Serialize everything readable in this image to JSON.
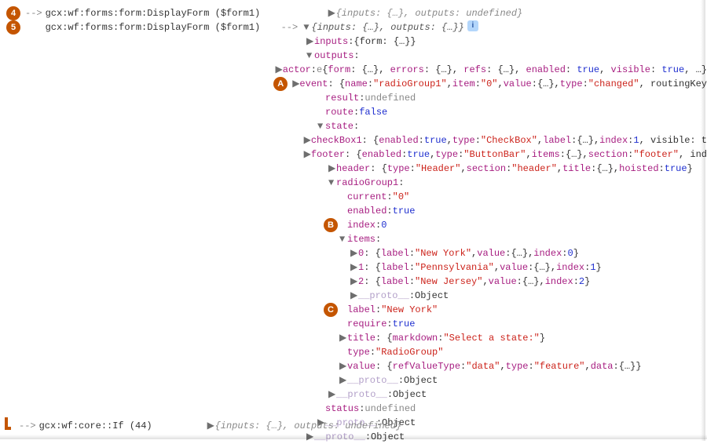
{
  "badges": {
    "n4": "4",
    "n5": "5",
    "A": "A",
    "B": "B",
    "C": "C"
  },
  "log": {
    "entry4": {
      "prefix": "-->",
      "fn": "gcx:wf:forms:form:DisplayForm ($form1)",
      "summary": "{inputs: {…}, outputs: undefined}"
    },
    "entry5": {
      "fn": "gcx:wf:forms:form:DisplayForm ($form1)",
      "arrow": "-->",
      "summary": "{inputs: {…}, outputs: {…}}"
    },
    "bottom": {
      "prefix": "-->",
      "fn": "gcx:wf:core::If (44)",
      "summary": "{inputs: {…}, outputs: undefined}"
    }
  },
  "inputs_line": {
    "key": "inputs",
    "val": "{form: {…}}"
  },
  "outputs_label": "outputs",
  "actor": {
    "key": "actor",
    "prefix": "e ",
    "val": "{form: {…}, errors: {…}, refs: {…}, enabled: true, visible: true, …}"
  },
  "event": {
    "key": "event",
    "name_k": "name",
    "name_v": "\"radioGroup1\"",
    "item_k": "item",
    "item_v": "\"0\"",
    "value_k": "value",
    "value_v": "{…}",
    "type_k": "type",
    "type_v": "\"changed\"",
    "rest": ", routingKey"
  },
  "result": {
    "key": "result",
    "val": "undefined"
  },
  "route": {
    "key": "route",
    "val": "false"
  },
  "state_label": "state",
  "checkBox1": {
    "key": "checkBox1",
    "enabled_k": "enabled",
    "enabled_v": "true",
    "type_k": "type",
    "type_v": "\"CheckBox\"",
    "label_k": "label",
    "label_v": "{…}",
    "index_k": "index",
    "index_v": "1",
    "rest": ", visible: t"
  },
  "footer": {
    "key": "footer",
    "enabled_k": "enabled",
    "enabled_v": "true",
    "type_k": "type",
    "type_v": "\"ButtonBar\"",
    "items_k": "items",
    "items_v": "{…}",
    "section_k": "section",
    "section_v": "\"footer\"",
    "rest": ", ind"
  },
  "header": {
    "key": "header",
    "type_k": "type",
    "type_v": "\"Header\"",
    "section_k": "section",
    "section_v": "\"header\"",
    "title_k": "title",
    "title_v": "{…}",
    "hoisted_k": "hoisted",
    "hoisted_v": "true"
  },
  "radioGroup1_label": "radioGroup1",
  "rg": {
    "current_k": "current",
    "current_v": "\"0\"",
    "enabled_k": "enabled",
    "enabled_v": "true",
    "index_k": "index",
    "index_v": "0",
    "items_label": "items",
    "item0": {
      "idx": "0",
      "label_k": "label",
      "label_v": "\"New York\"",
      "value_k": "value",
      "value_v": "{…}",
      "index_k": "index",
      "index_v": "0"
    },
    "item1": {
      "idx": "1",
      "label_k": "label",
      "label_v": "\"Pennsylvania\"",
      "value_k": "value",
      "value_v": "{…}",
      "index_k": "index",
      "index_v": "1"
    },
    "item2": {
      "idx": "2",
      "label_k": "label",
      "label_v": "\"New Jersey\"",
      "value_k": "value",
      "value_v": "{…}",
      "index_k": "index",
      "index_v": "2"
    },
    "proto_items": "__proto__",
    "proto_items_v": "Object",
    "label_k": "label",
    "label_v": "\"New York\"",
    "require_k": "require",
    "require_v": "true",
    "title_k": "title",
    "title_md_k": "markdown",
    "title_md_v": "\"Select a state:\"",
    "type_k": "type",
    "type_v": "\"RadioGroup\"",
    "value_k": "value",
    "value_refType_k": "refValueType",
    "value_refType_v": "\"data\"",
    "value_type_k": "type",
    "value_type_v": "\"feature\"",
    "value_data_k": "data",
    "value_data_v": "{…}",
    "proto_rg": "__proto__",
    "proto_rg_v": "Object"
  },
  "state_proto": {
    "k": "__proto__",
    "v": "Object"
  },
  "status": {
    "k": "status",
    "v": "undefined"
  },
  "outputs_proto": {
    "k": "__proto__",
    "v": "Object"
  },
  "root_proto": {
    "k": "__proto__",
    "v": "Object"
  },
  "tri": {
    "right": "▶",
    "down": "▼"
  }
}
